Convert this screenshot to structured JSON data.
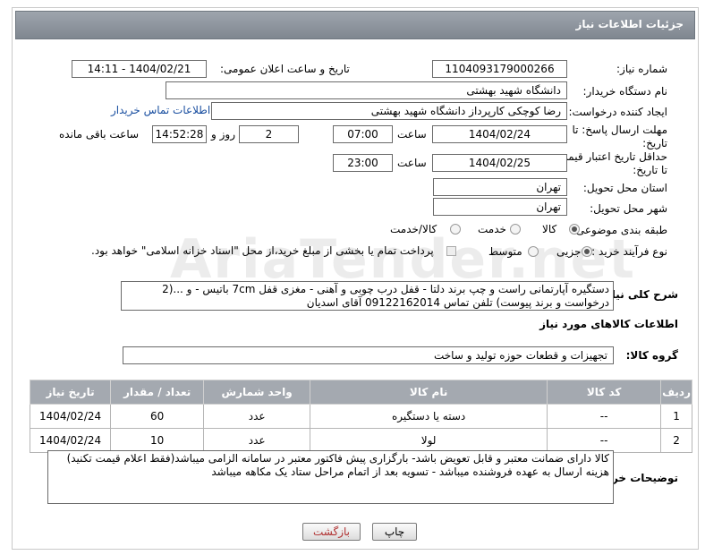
{
  "header": {
    "title": "جزئیات اطلاعات نیاز"
  },
  "fields": {
    "need_number_label": "شماره نیاز:",
    "need_number": "1104093179000266",
    "announce_label": "تاریخ و ساعت اعلان عمومی:",
    "announce_value": "1404/02/21 - 14:11",
    "buyer_org_label": "نام دستگاه خریدار:",
    "buyer_org": "دانشگاه شهید بهشتی",
    "requester_label": "ایجاد کننده درخواست:",
    "requester": "رضا کوچکی کارپرداز دانشگاه شهید بهشتی",
    "contact_link": "اطلاعات تماس خریدار",
    "deadline_label": "مهلت ارسال پاسخ: تا تاریخ:",
    "deadline_date": "1404/02/24",
    "time_word": "ساعت",
    "deadline_time": "07:00",
    "days_value": "2",
    "days_word": "روز و",
    "remaining_time": "14:52:28",
    "remaining_word": "ساعت باقی مانده",
    "validity_label": "حداقل تاریخ اعتبار قیمت: تا تاریخ:",
    "validity_date": "1404/02/25",
    "validity_time": "23:00",
    "province_label": "استان محل تحویل:",
    "province": "تهران",
    "city_label": "شهر محل تحویل:",
    "city": "تهران",
    "category_label": "طبقه بندی موضوعی:",
    "category_options": [
      "کالا",
      "خدمت",
      "کالا/خدمت"
    ],
    "category_selected": "کالا",
    "process_label": "نوع فرآیند خرید :",
    "process_options": [
      "جزیی",
      "متوسط"
    ],
    "process_selected": "جزیی",
    "payment_note": "پرداخت تمام یا بخشی از مبلغ خرید،از محل \"اسناد خزانه اسلامی\" خواهد بود."
  },
  "description": {
    "label": "شرح کلی نیاز:",
    "line1": "دستگیره آپارتمانی راست و چپ برند دلتا  - قفل درب چوبی و آهنی - مغزی قفل 7cm  باتیس - و ...(2",
    "line2": "درخواست و برند پیوست) تلفن  تماس 09122162014 آقای اسدیان"
  },
  "goods_section": {
    "title": "اطلاعات کالاهای مورد نیاز",
    "group_label": "گروه کالا:",
    "group_value": "تجهیزات و قطعات حوزه تولید و ساخت"
  },
  "table": {
    "headers": [
      "ردیف",
      "کد کالا",
      "نام کالا",
      "واحد شمارش",
      "تعداد / مقدار",
      "تاریخ نیاز"
    ],
    "rows": [
      [
        "1",
        "--",
        "دسته یا دستگیره",
        "عدد",
        "60",
        "1404/02/24"
      ],
      [
        "2",
        "--",
        "لولا",
        "عدد",
        "10",
        "1404/02/24"
      ]
    ]
  },
  "buyer_notes": {
    "label": "توضیحات خریدار:",
    "line1": "کالا دارای ضمانت معتبر و قابل تعویض باشد- بارگزاری پیش فاکتور معتبر در سامانه الزامی میباشد(فقط اعلام قیمت تکنید)",
    "line2": "هزینه ارسال به عهده فروشنده میباشد - تسویه بعد از اتمام مراحل ستاد یک مکاهه میباشد"
  },
  "buttons": {
    "print": "چاپ",
    "back": "بازگشت"
  },
  "colors": {
    "titlebar": "#8a9199",
    "link": "#1a4fa0",
    "table_header": "#a4a9b0",
    "back_button_text": "#b03030"
  }
}
